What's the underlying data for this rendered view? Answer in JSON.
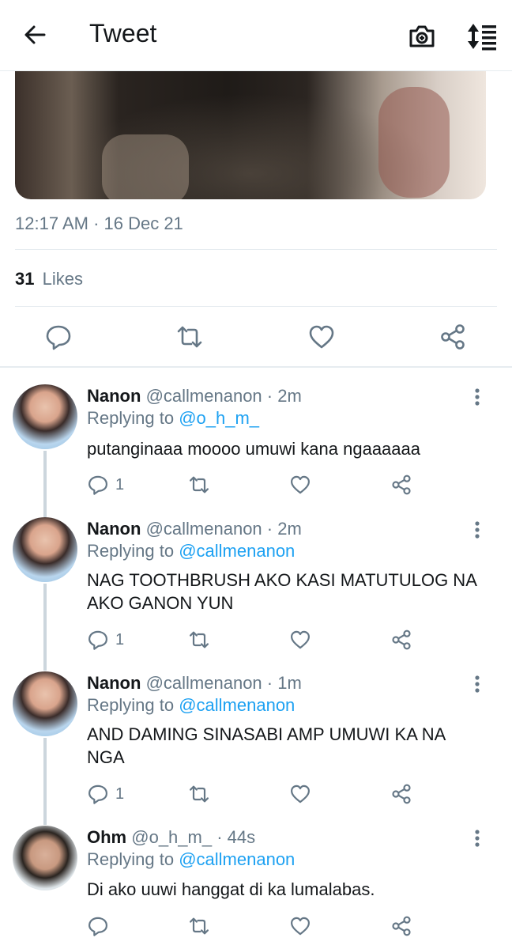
{
  "header": {
    "title": "Tweet"
  },
  "tweet": {
    "timestamp": "12:17 AM · 16 Dec 21",
    "likes_count": "31",
    "likes_label": "Likes"
  },
  "replies": [
    {
      "name": "Nanon",
      "handle": "@callmenanon",
      "time": "· 2m",
      "replying_prefix": "Replying to",
      "replying_to": "@o_h_m_",
      "text": "putanginaaa moooo umuwi kana ngaaaaaa",
      "reply_count": "1"
    },
    {
      "name": "Nanon",
      "handle": "@callmenanon",
      "time": "· 2m",
      "replying_prefix": "Replying to",
      "replying_to": "@callmenanon",
      "text": "NAG TOOTHBRUSH AKO KASI MATUTULOG NA AKO GANON YUN",
      "reply_count": "1"
    },
    {
      "name": "Nanon",
      "handle": "@callmenanon",
      "time": "· 1m",
      "replying_prefix": "Replying to",
      "replying_to": "@callmenanon",
      "text": "AND DAMING SINASABI AMP UMUWI KA NA NGA",
      "reply_count": "1"
    },
    {
      "name": "Ohm",
      "handle": "@o_h_m_",
      "time": "· 44s",
      "replying_prefix": "Replying to",
      "replying_to": "@callmenanon",
      "text": "Di ako uuwi hanggat di ka lumalabas.",
      "reply_count": ""
    }
  ],
  "colors": {
    "accent": "#1da1f2",
    "secondary_text": "#657786",
    "divider": "#e6ecf0"
  },
  "icons": [
    "back-arrow-icon",
    "camera-icon",
    "sort-icon",
    "reply-icon",
    "retweet-icon",
    "like-icon",
    "share-icon",
    "more-icon"
  ]
}
